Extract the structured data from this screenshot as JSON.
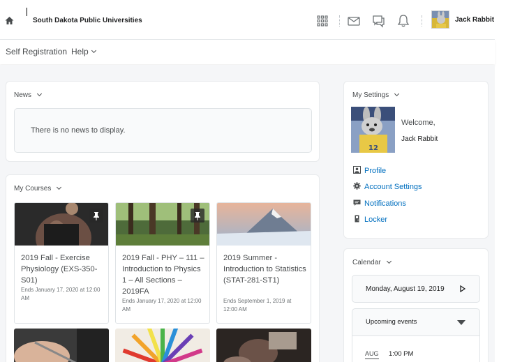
{
  "header": {
    "org_name": "South Dakota Public Universities",
    "user_name": "Jack Rabbit",
    "icons": [
      "home-icon",
      "waffle-icon",
      "mail-icon",
      "chat-icon",
      "bell-icon"
    ]
  },
  "nav": {
    "self_registration": "Self Registration",
    "help": "Help"
  },
  "news": {
    "title": "News",
    "empty_message": "There is no news to display."
  },
  "courses": {
    "title": "My Courses",
    "items": [
      {
        "title": "2019 Fall - Exercise Physiology (EXS-350-S01)",
        "date": "Ends January 17, 2020 at 12:00 AM",
        "pinned": true
      },
      {
        "title": "2019 Fall - PHY – 111 – Introduction to Physics 1 – All Sections – 2019FA",
        "date": "Ends January 17, 2020 at 12:00 AM",
        "pinned": true
      },
      {
        "title": "2019 Summer - Introduction to Statistics (STAT-281-ST1)",
        "date": "Ends September 1, 2019 at 12:00 AM",
        "pinned": false
      }
    ]
  },
  "settings": {
    "title": "My Settings",
    "welcome": "Welcome,",
    "name": "Jack Rabbit",
    "links": {
      "profile": "Profile",
      "account": "Account Settings",
      "notifications": "Notifications",
      "locker": "Locker"
    }
  },
  "calendar": {
    "title": "Calendar",
    "date": "Monday, August 19, 2019",
    "upcoming": "Upcoming events",
    "event_month": "AUG",
    "event_time": "1:00 PM"
  },
  "colors": {
    "link": "#006fbf",
    "page_bg": "#f5f6f8",
    "text": "#494c4e"
  }
}
